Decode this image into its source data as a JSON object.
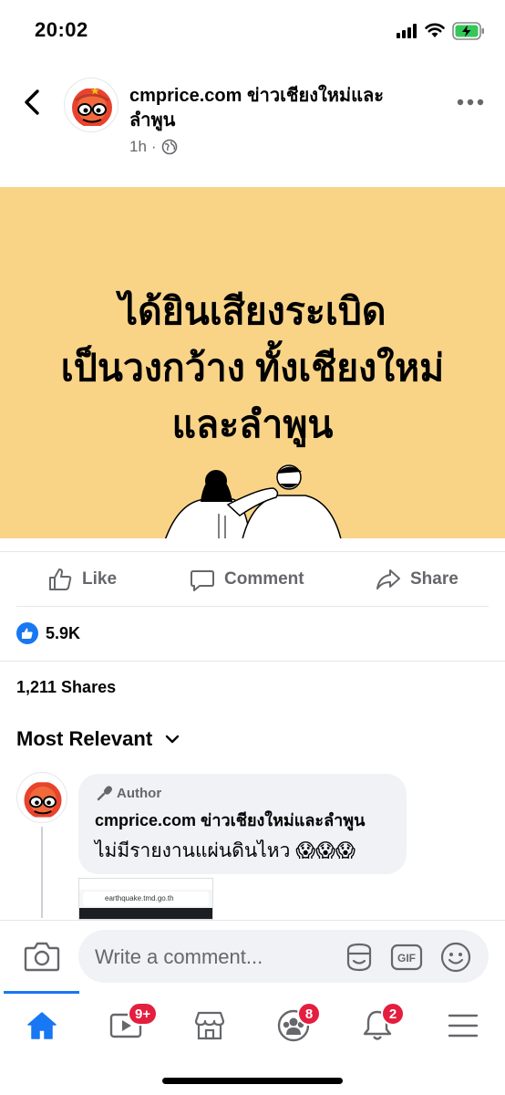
{
  "status_bar": {
    "time": "20:02"
  },
  "post": {
    "page_name": "cmprice.com ข่าวเชียงใหม่และลำพูน",
    "time_ago": "1h",
    "separator": "·",
    "banner_lines": [
      "ได้ยินเสียงระเบิด",
      "เป็นวงกว้าง ทั้งเชียงใหม่",
      "และลำพูน"
    ],
    "banner_color": "#f9d487",
    "actions": {
      "like": "Like",
      "comment": "Comment",
      "share": "Share"
    },
    "reaction_count": "5.9K",
    "shares": "1,211 Shares"
  },
  "comments": {
    "sort_label": "Most Relevant",
    "first": {
      "badge": "Author",
      "name": "cmprice.com ข่าวเชียงใหม่และลำพูน",
      "text": "ไม่มีรายงานแผ่นดินไหว 😱😱😱",
      "attachment_url": "earthquake.tmd.go.th"
    }
  },
  "composer": {
    "placeholder": "Write a comment..."
  },
  "nav": {
    "badges": {
      "watch": "9+",
      "groups": "8",
      "notifications": "2"
    }
  },
  "colors": {
    "accent": "#1877f2",
    "badge": "#e41e3f",
    "muted": "#65676b"
  }
}
